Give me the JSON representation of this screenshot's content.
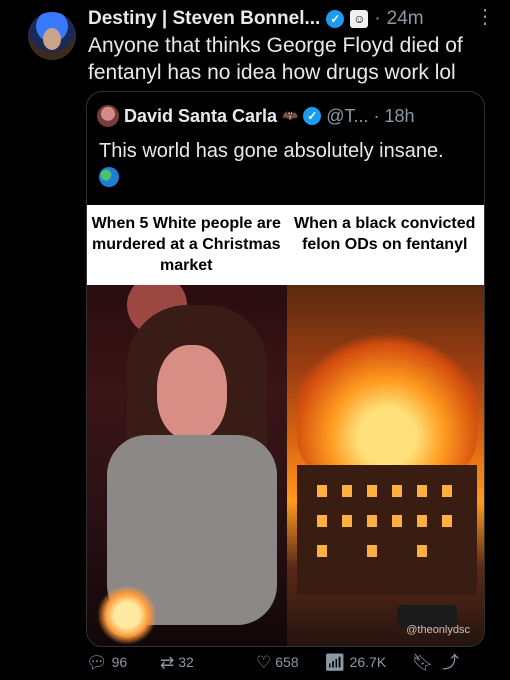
{
  "tweet": {
    "author_name": "Destiny | Steven Bonnel...",
    "separator": "·",
    "time": "24m",
    "more_icon": "⋮",
    "text": "Anyone that thinks George Floyd died of fentanyl has no idea how drugs work lol"
  },
  "quote": {
    "author_name": "David Santa Carla",
    "handle": "@T...",
    "separator": "·",
    "time": "18h",
    "text": "This world has gone absolutely insane.",
    "captions": {
      "left": "When 5 White people are murdered at a Christmas market",
      "right": "When a black convicted felon ODs on fentanyl"
    },
    "watermark": "@theonlydsc"
  },
  "actions": {
    "replies": "96",
    "reposts": "32",
    "likes": "658",
    "views": "26.7K"
  },
  "colors": {
    "background": "#000000",
    "text": "#e7e9ea",
    "muted": "#8b98a5",
    "verified": "#1d9bf0",
    "border": "#2f3336"
  },
  "icons": [
    "verified-badge-icon",
    "affiliate-badge-icon",
    "more-icon",
    "reply-icon",
    "repost-icon",
    "like-icon",
    "views-icon",
    "bookmark-icon",
    "share-icon",
    "globe-emoji-icon",
    "bat-icon"
  ]
}
